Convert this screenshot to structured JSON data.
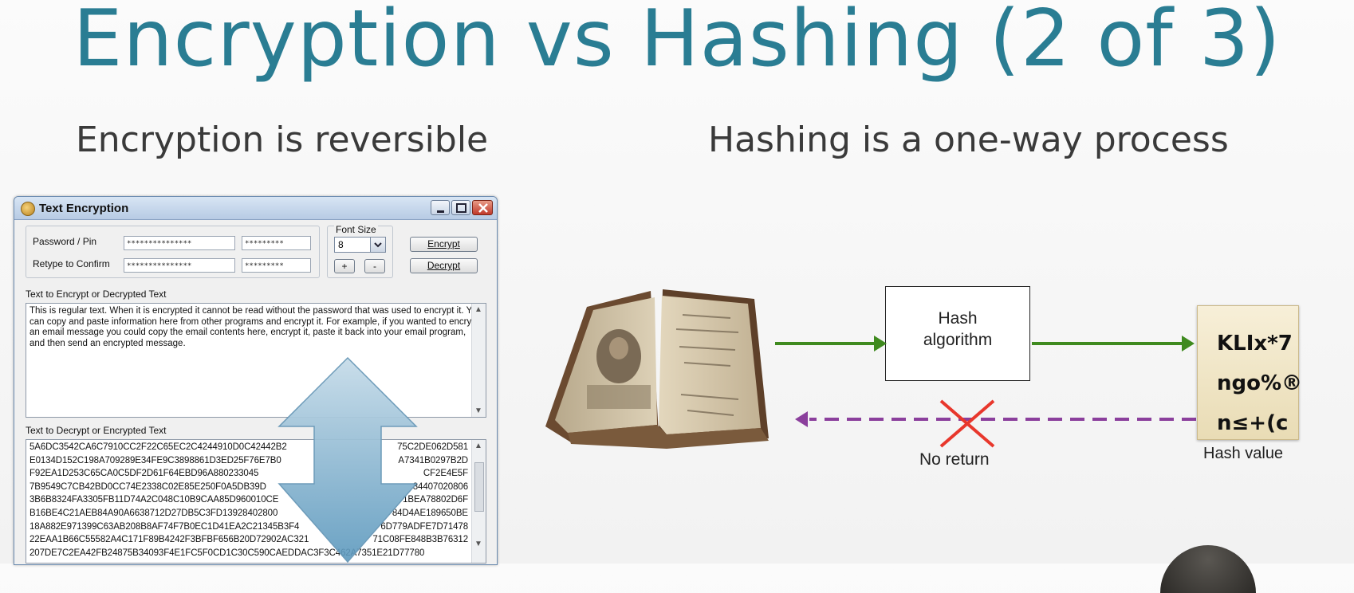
{
  "slide": {
    "title": "Encryption vs Hashing (2 of 3)",
    "left_heading": "Encryption is reversible",
    "right_heading": "Hashing is a one-way process"
  },
  "window": {
    "title": "Text Encryption",
    "password_label": "Password / Pin",
    "retype_label": "Retype to Confirm",
    "password_value": "***************",
    "password_short": "*********",
    "retype_value": "***************",
    "retype_short": "*********",
    "font_size_label": "Font Size",
    "font_size_value": "8",
    "plus_label": "+",
    "minus_label": "-",
    "encrypt_label": "Encrypt",
    "decrypt_label": "Decrypt",
    "plain_label": "Text to Encrypt or Decrypted Text",
    "plain_text": "This is regular text. When it is encrypted it cannot be read without the password that was used to encrypt it. You can copy and paste information here from other programs and encrypt it. For example, if you wanted to encrypt an email message you could copy the email contents here, encrypt it, paste it back into your email program, and then send an encrypted message.",
    "cipher_label": "Text to Decrypt or Encrypted Text",
    "cipher_lines": [
      "5A6DC3542CA6C7910CC2F22C65EC2C4244910D0C42442B2",
      "E0134D152C198A709289E34FE9C3898861D3ED25F76E7B0",
      "F92EA1D253C65CA0C5DF2D61F64EBD96A880233045",
      "7B9549C7CB42BD0CC74E2338C02E85E250F0A5DB39D",
      "3B6B8324FA3305FB11D74A2C048C10B9CAA85D960010CE",
      "B16BE4C21AEB84A90A6638712D27DB5C3FD13928402800",
      "18A882E971399C63AB208B8AF74F7B0EC1D41EA2C21345B3F4",
      "22EAA1B66C55582A4C171F89B4242F3BFBF656B20D72902AC321",
      "207DE7C2EA42FB24875B34093F4E1FC5F0CD1C30C590CAEDDAC3F3C462A7351E21D77780"
    ],
    "cipher_lines_right": [
      "75C2DE062D581",
      "A7341B0297B2D",
      "CF2E4E5F",
      "84407020806",
      "1BEA78802D6F",
      "84D4AE189650BE",
      "6D779ADFE7D71478",
      "71C08FE848B3B76312",
      ""
    ]
  },
  "diagram": {
    "hash_box_line1": "Hash",
    "hash_box_line2": "algorithm",
    "no_return_label": "No return",
    "hash_value_label": "Hash value",
    "hash_lines": [
      "KLIx*7",
      "ngo%®",
      "n≤+(c"
    ],
    "colors": {
      "forward_arrow": "#3f8a1f",
      "return_arrow": "#8b3f9c",
      "cross": "#e8372c",
      "title": "#2a7d93"
    }
  }
}
